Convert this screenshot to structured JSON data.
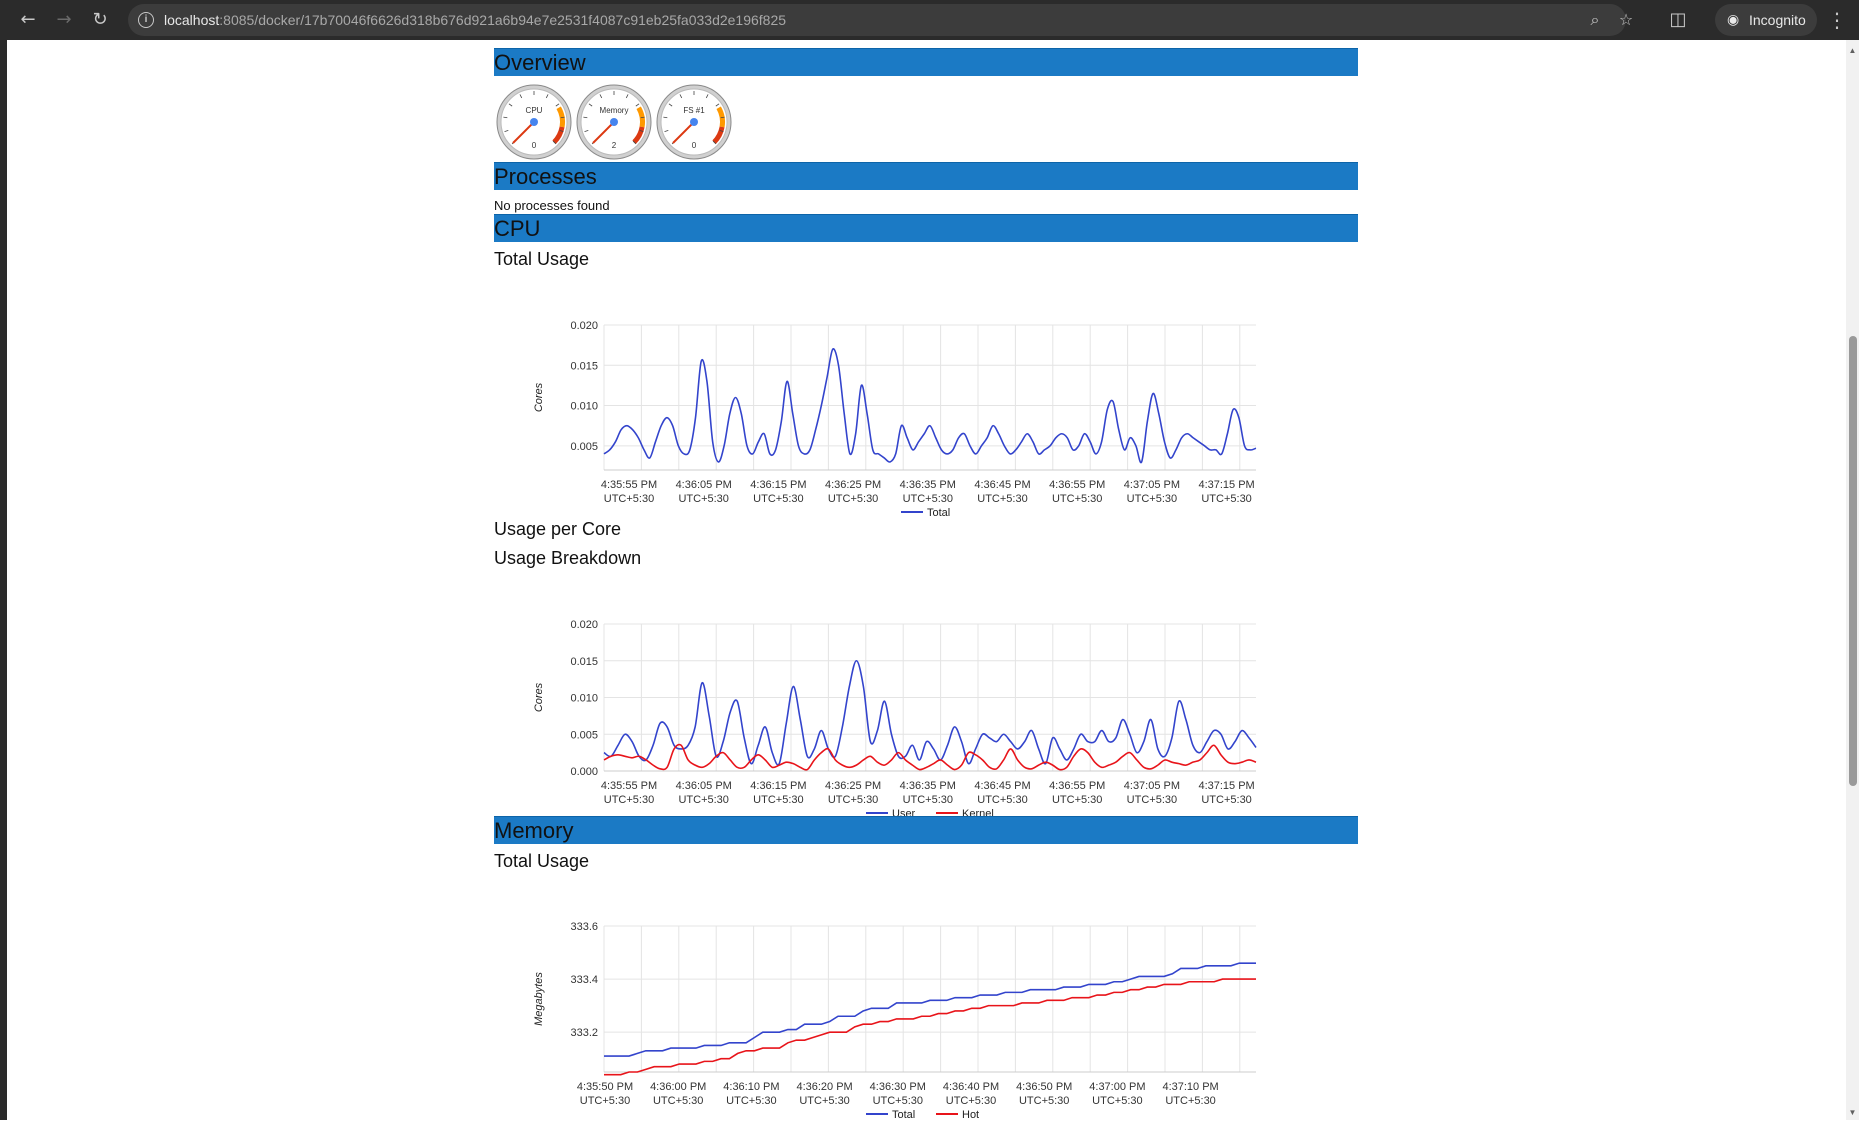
{
  "browser": {
    "url_host": "localhost",
    "url_path": ":8085/docker/17b70046f6626d318b676d921a6b94e7e2531f4087c91eb25fa033d2e196f825",
    "incognito_label": "Incognito"
  },
  "sections": {
    "overview": "Overview",
    "processes": "Processes",
    "cpu": "CPU",
    "memory": "Memory"
  },
  "processes_text": "No processes found",
  "subheadings": {
    "cpu_total": "Total Usage",
    "cpu_per_core": "Usage per Core",
    "cpu_breakdown": "Usage Breakdown",
    "mem_total": "Total Usage"
  },
  "gauges": [
    {
      "label": "CPU",
      "value": "0"
    },
    {
      "label": "Memory",
      "value": "2"
    },
    {
      "label": "FS #1",
      "value": "0"
    }
  ],
  "colors": {
    "header_blue": "#1b7ac5",
    "series_blue": "#3344cc",
    "series_red": "#e8141a"
  },
  "chart_data": [
    {
      "type": "line",
      "ylabel": "Cores",
      "ylim": [
        0.002,
        0.02
      ],
      "yticks": [
        "0.020",
        "0.015",
        "0.010",
        "0.005"
      ],
      "x_tick_labels": [
        [
          "4:35:55 PM",
          "UTC+5:30"
        ],
        [
          "4:36:05 PM",
          "UTC+5:30"
        ],
        [
          "4:36:15 PM",
          "UTC+5:30"
        ],
        [
          "4:36:25 PM",
          "UTC+5:30"
        ],
        [
          "4:36:35 PM",
          "UTC+5:30"
        ],
        [
          "4:36:45 PM",
          "UTC+5:30"
        ],
        [
          "4:36:55 PM",
          "UTC+5:30"
        ],
        [
          "4:37:05 PM",
          "UTC+5:30"
        ],
        [
          "4:37:15 PM",
          "UTC+5:30"
        ]
      ],
      "x_start": "4:35:50 PM",
      "x_step_seconds": 1,
      "series": [
        {
          "name": "Total",
          "color": "#3344cc",
          "values": [
            0.004,
            0.0045,
            0.0055,
            0.007,
            0.0075,
            0.007,
            0.006,
            0.0045,
            0.0035,
            0.0055,
            0.0075,
            0.0085,
            0.0075,
            0.005,
            0.004,
            0.0045,
            0.0085,
            0.0155,
            0.013,
            0.0055,
            0.003,
            0.005,
            0.009,
            0.011,
            0.009,
            0.005,
            0.004,
            0.0055,
            0.0065,
            0.004,
            0.0045,
            0.008,
            0.013,
            0.009,
            0.005,
            0.004,
            0.0045,
            0.007,
            0.01,
            0.0135,
            0.017,
            0.015,
            0.009,
            0.004,
            0.0065,
            0.0125,
            0.009,
            0.0045,
            0.004,
            0.0035,
            0.003,
            0.004,
            0.0075,
            0.006,
            0.0045,
            0.0055,
            0.0065,
            0.0075,
            0.006,
            0.0045,
            0.004,
            0.0045,
            0.006,
            0.0065,
            0.005,
            0.004,
            0.005,
            0.006,
            0.0075,
            0.0065,
            0.005,
            0.004,
            0.0045,
            0.0055,
            0.0065,
            0.0055,
            0.004,
            0.0045,
            0.005,
            0.006,
            0.0065,
            0.006,
            0.0045,
            0.005,
            0.0065,
            0.0055,
            0.004,
            0.0055,
            0.0095,
            0.0105,
            0.007,
            0.0045,
            0.006,
            0.005,
            0.003,
            0.008,
            0.0115,
            0.009,
            0.0055,
            0.0035,
            0.0045,
            0.006,
            0.0065,
            0.006,
            0.0055,
            0.005,
            0.0045,
            0.0045,
            0.004,
            0.0065,
            0.0095,
            0.0085,
            0.005,
            0.0045,
            0.0047
          ]
        }
      ]
    },
    {
      "type": "line",
      "ylabel": "Cores",
      "ylim": [
        0.0,
        0.02
      ],
      "yticks": [
        "0.020",
        "0.015",
        "0.010",
        "0.005",
        "0.000"
      ],
      "x_tick_labels": [
        [
          "4:35:55 PM",
          "UTC+5:30"
        ],
        [
          "4:36:05 PM",
          "UTC+5:30"
        ],
        [
          "4:36:15 PM",
          "UTC+5:30"
        ],
        [
          "4:36:25 PM",
          "UTC+5:30"
        ],
        [
          "4:36:35 PM",
          "UTC+5:30"
        ],
        [
          "4:36:45 PM",
          "UTC+5:30"
        ],
        [
          "4:36:55 PM",
          "UTC+5:30"
        ],
        [
          "4:37:05 PM",
          "UTC+5:30"
        ],
        [
          "4:37:15 PM",
          "UTC+5:30"
        ]
      ],
      "x_start": "4:35:50 PM",
      "x_step_seconds": 1,
      "series": [
        {
          "name": "User",
          "color": "#3344cc",
          "values": [
            0.0025,
            0.002,
            0.0035,
            0.005,
            0.004,
            0.002,
            0.0015,
            0.0035,
            0.0065,
            0.006,
            0.0035,
            0.003,
            0.0035,
            0.006,
            0.012,
            0.0075,
            0.002,
            0.004,
            0.008,
            0.0095,
            0.0045,
            0.001,
            0.0035,
            0.006,
            0.0025,
            0.001,
            0.0065,
            0.0115,
            0.007,
            0.002,
            0.003,
            0.0055,
            0.003,
            0.002,
            0.006,
            0.0115,
            0.015,
            0.0115,
            0.004,
            0.0055,
            0.0095,
            0.005,
            0.002,
            0.002,
            0.0035,
            0.0015,
            0.004,
            0.003,
            0.0015,
            0.0035,
            0.006,
            0.004,
            0.001,
            0.003,
            0.005,
            0.0045,
            0.004,
            0.005,
            0.004,
            0.003,
            0.004,
            0.0055,
            0.003,
            0.001,
            0.0045,
            0.003,
            0.0015,
            0.003,
            0.005,
            0.004,
            0.004,
            0.0055,
            0.004,
            0.0045,
            0.007,
            0.005,
            0.0025,
            0.004,
            0.007,
            0.003,
            0.002,
            0.0045,
            0.0095,
            0.007,
            0.0035,
            0.0025,
            0.004,
            0.0055,
            0.005,
            0.003,
            0.004,
            0.0055,
            0.0045,
            0.0032
          ]
        },
        {
          "name": "Kernel",
          "color": "#e8141a",
          "values": [
            0.0015,
            0.002,
            0.0022,
            0.002,
            0.0018,
            0.002,
            0.0015,
            0.0008,
            0.0003,
            0.0005,
            0.003,
            0.0035,
            0.0015,
            0.0008,
            0.0005,
            0.001,
            0.002,
            0.0025,
            0.0015,
            0.0005,
            0.0005,
            0.0015,
            0.0022,
            0.0015,
            0.0005,
            0.0008,
            0.0012,
            0.001,
            0.0005,
            0.0002,
            0.0015,
            0.0025,
            0.003,
            0.0015,
            0.0008,
            0.0005,
            0.0008,
            0.0015,
            0.002,
            0.0012,
            0.0008,
            0.0015,
            0.0025,
            0.0015,
            0.0008,
            0.0002,
            0.0005,
            0.001,
            0.0015,
            0.0008,
            0.0002,
            0.0008,
            0.0025,
            0.0022,
            0.0015,
            0.0005,
            0.0003,
            0.0015,
            0.003,
            0.0015,
            0.0005,
            0.0003,
            0.0008,
            0.0012,
            0.0008,
            0.0002,
            0.0005,
            0.002,
            0.003,
            0.0025,
            0.0012,
            0.0005,
            0.0008,
            0.0012,
            0.002,
            0.0025,
            0.0015,
            0.0005,
            0.0003,
            0.0008,
            0.0015,
            0.0012,
            0.001,
            0.0008,
            0.0012,
            0.0015,
            0.0025,
            0.0035,
            0.0022,
            0.0012,
            0.001,
            0.0012,
            0.0015,
            0.0012
          ]
        }
      ]
    },
    {
      "type": "line",
      "ylabel": "Megabytes",
      "ylim": [
        333.05,
        333.6
      ],
      "yticks": [
        "333.6",
        "333.4",
        "333.2"
      ],
      "x_tick_labels": [
        [
          "4:35:50 PM",
          "UTC+5:30"
        ],
        [
          "4:36:00 PM",
          "UTC+5:30"
        ],
        [
          "4:36:10 PM",
          "UTC+5:30"
        ],
        [
          "4:36:20 PM",
          "UTC+5:30"
        ],
        [
          "4:36:30 PM",
          "UTC+5:30"
        ],
        [
          "4:36:40 PM",
          "UTC+5:30"
        ],
        [
          "4:36:50 PM",
          "UTC+5:30"
        ],
        [
          "4:37:00 PM",
          "UTC+5:30"
        ],
        [
          "4:37:10 PM",
          "UTC+5:30"
        ]
      ],
      "x_start": "4:35:50 PM",
      "x_step_seconds": 1,
      "series": [
        {
          "name": "Total",
          "color": "#3344cc",
          "values": [
            333.11,
            333.11,
            333.11,
            333.11,
            333.12,
            333.13,
            333.13,
            333.13,
            333.14,
            333.14,
            333.14,
            333.14,
            333.15,
            333.15,
            333.15,
            333.16,
            333.16,
            333.16,
            333.18,
            333.2,
            333.2,
            333.2,
            333.21,
            333.21,
            333.23,
            333.23,
            333.23,
            333.24,
            333.26,
            333.26,
            333.26,
            333.28,
            333.29,
            333.29,
            333.29,
            333.31,
            333.31,
            333.31,
            333.31,
            333.32,
            333.32,
            333.32,
            333.33,
            333.33,
            333.33,
            333.34,
            333.34,
            333.34,
            333.35,
            333.35,
            333.35,
            333.36,
            333.36,
            333.36,
            333.36,
            333.37,
            333.37,
            333.37,
            333.38,
            333.38,
            333.38,
            333.39,
            333.39,
            333.4,
            333.41,
            333.41,
            333.41,
            333.41,
            333.42,
            333.44,
            333.44,
            333.44,
            333.45,
            333.45,
            333.45,
            333.45,
            333.46,
            333.46,
            333.46
          ]
        },
        {
          "name": "Hot",
          "color": "#e8141a",
          "values": [
            333.04,
            333.04,
            333.04,
            333.05,
            333.05,
            333.06,
            333.07,
            333.07,
            333.07,
            333.08,
            333.08,
            333.08,
            333.09,
            333.09,
            333.1,
            333.1,
            333.12,
            333.13,
            333.13,
            333.14,
            333.14,
            333.14,
            333.16,
            333.17,
            333.17,
            333.18,
            333.19,
            333.2,
            333.2,
            333.2,
            333.22,
            333.23,
            333.23,
            333.24,
            333.24,
            333.25,
            333.25,
            333.25,
            333.26,
            333.26,
            333.27,
            333.27,
            333.28,
            333.28,
            333.29,
            333.29,
            333.3,
            333.3,
            333.3,
            333.3,
            333.31,
            333.31,
            333.31,
            333.32,
            333.32,
            333.32,
            333.33,
            333.33,
            333.33,
            333.34,
            333.34,
            333.35,
            333.35,
            333.36,
            333.36,
            333.37,
            333.37,
            333.38,
            333.38,
            333.38,
            333.39,
            333.39,
            333.39,
            333.39,
            333.4,
            333.4,
            333.4,
            333.4,
            333.4
          ]
        }
      ]
    }
  ]
}
